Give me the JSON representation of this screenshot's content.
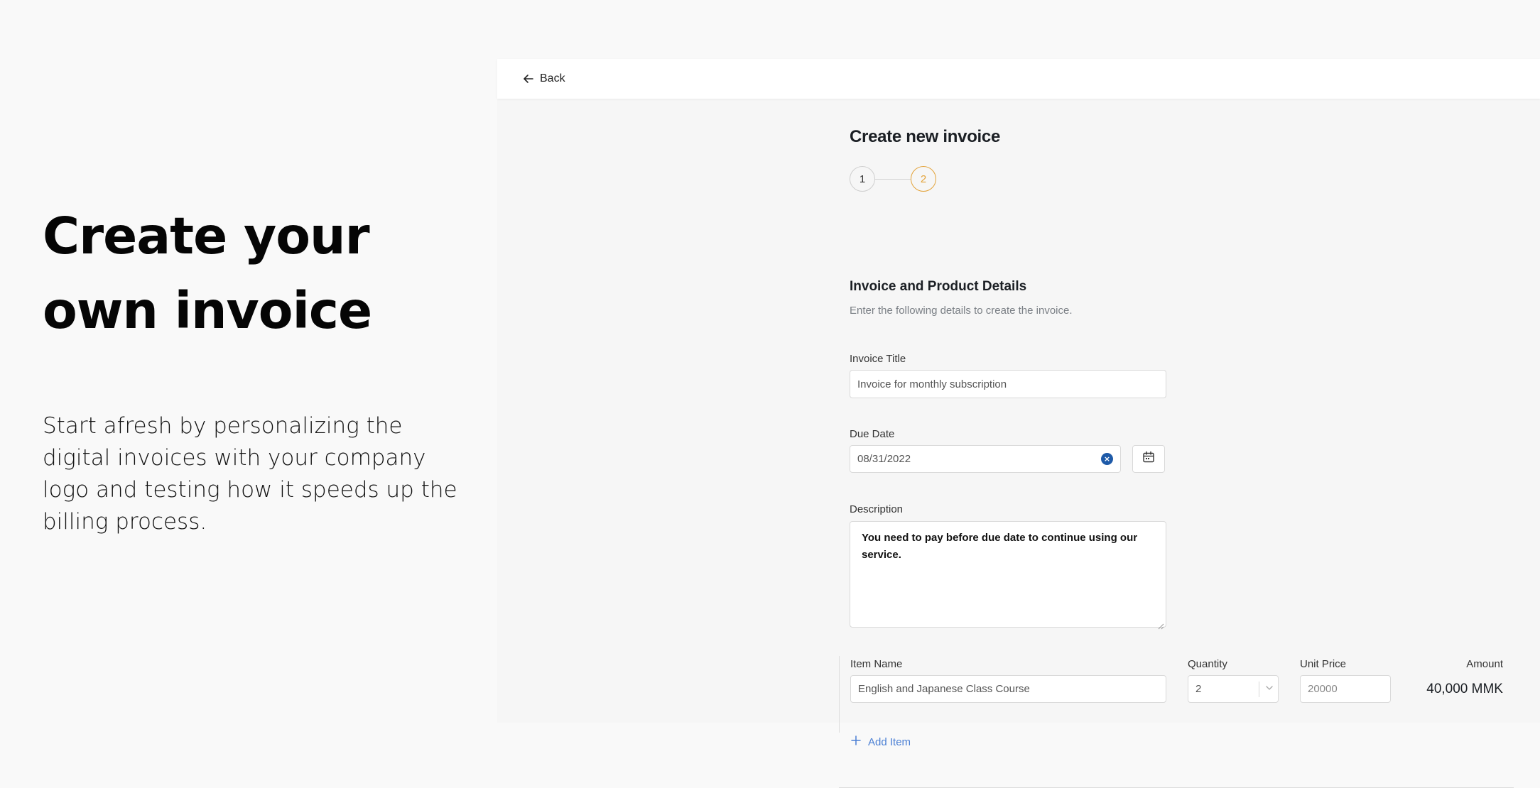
{
  "hero": {
    "title": "Create your own invoice",
    "description": "Start afresh by personalizing the digital invoices with your company logo and testing how it  speeds up the billing process."
  },
  "topbar": {
    "back_label": "Back",
    "back_icon": "arrow-left-icon"
  },
  "form": {
    "title": "Create new invoice",
    "steps": [
      "1",
      "2"
    ],
    "active_step": 2,
    "section_title": "Invoice and Product Details",
    "section_subtitle": "Enter the following details to create the invoice.",
    "invoice_title": {
      "label": "Invoice Title",
      "value": "Invoice for monthly subscription"
    },
    "due_date": {
      "label": "Due Date",
      "value": "08/31/2022",
      "clear_icon": "clear-circle-icon",
      "calendar_icon": "calendar-icon"
    },
    "description": {
      "label": "Description",
      "value": "You need to pay before due date to continue using our service."
    },
    "items": {
      "headers": {
        "name": "Item Name",
        "quantity": "Quantity",
        "unit_price": "Unit Price",
        "amount": "Amount"
      },
      "rows": [
        {
          "name": "English and Japanese Class Course",
          "quantity": "2",
          "unit_price": "20000",
          "amount": "40,000 MMK"
        }
      ],
      "add_label": "Add Item"
    }
  },
  "colors": {
    "accent_step": "#e3a33a",
    "link_blue": "#4a7fd4",
    "clear_blue": "#1e5aa8"
  }
}
